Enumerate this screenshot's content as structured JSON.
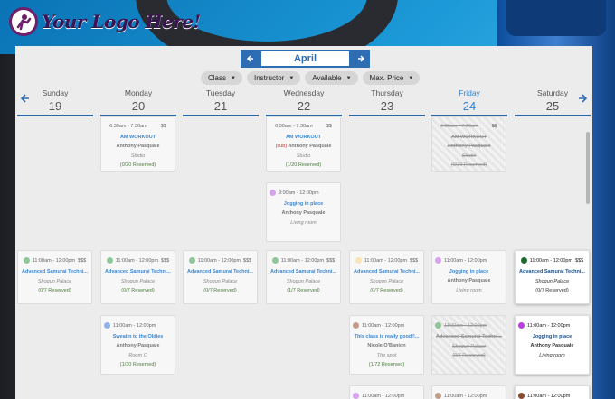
{
  "logo": {
    "text": "Your Logo Here!"
  },
  "month": {
    "name": "April",
    "prev_label": "←",
    "next_label": "→"
  },
  "filters": [
    {
      "label": "Class"
    },
    {
      "label": "Instructor"
    },
    {
      "label": "Available"
    },
    {
      "label": "Max. Price"
    }
  ],
  "days": [
    {
      "name": "Sunday",
      "num": "19"
    },
    {
      "name": "Monday",
      "num": "20"
    },
    {
      "name": "Tuesday",
      "num": "21"
    },
    {
      "name": "Wednesday",
      "num": "22"
    },
    {
      "name": "Thursday",
      "num": "23"
    },
    {
      "name": "Friday",
      "num": "24"
    },
    {
      "name": "Saturday",
      "num": "25"
    }
  ],
  "events": {
    "mon_am": {
      "time": "6:30am - 7:30am",
      "price": "$$",
      "title": "AM WORKOUT",
      "instructor": "Anthony Pasquale",
      "location": "Studio",
      "reserved": "(0/20 Reserved)"
    },
    "wed_am": {
      "time": "6:30am - 7:30am",
      "price": "$$",
      "title": "AM WORKOUT",
      "sub": "(sub)",
      "instructor": "Anthony Pasquale",
      "location": "Studio",
      "reserved": "(1/20 Reserved)"
    },
    "fri_am": {
      "time": "6:30am - 7:30am",
      "price": "$$",
      "title": "AM WORKOUT",
      "instructor": "Anthony Pasquale",
      "location": "Studio",
      "reserved": "(0/20 Reserved)"
    },
    "wed_jog": {
      "time": "9:00am - 12:00pm",
      "title": "Jogging in place",
      "instructor": "Anthony Pasquale",
      "location": "Living room",
      "color": "#d7a3ec"
    },
    "sun_samurai": {
      "time": "11:00am - 12:00pm",
      "price": "$$$",
      "title": "Advanced Samurai Techni...",
      "location": "Shogun Palace",
      "reserved": "(0/7 Reserved)",
      "color": "#8fc79a"
    },
    "mon_samurai": {
      "time": "11:00am - 12:00pm",
      "price": "$$$",
      "title": "Advanced Samurai Techni...",
      "location": "Shogun Palace",
      "reserved": "(0/7 Reserved)",
      "color": "#8fc79a"
    },
    "tue_samurai": {
      "time": "11:00am - 12:00pm",
      "price": "$$$",
      "title": "Advanced Samurai Techni...",
      "location": "Shogun Palace",
      "reserved": "(0/7 Reserved)",
      "color": "#8fc79a"
    },
    "wed_samurai": {
      "time": "11:00am - 12:00pm",
      "price": "$$$",
      "title": "Advanced Samurai Techni...",
      "location": "Shogun Palace",
      "reserved": "(1/7 Reserved)",
      "color": "#8fc79a"
    },
    "thu_samurai": {
      "time": "11:00am - 12:00pm",
      "price": "$$$",
      "title": "Advanced Samurai Techni...",
      "location": "Shogun Palace",
      "reserved": "(0/7 Reserved)",
      "color": "#fae3b5"
    },
    "fri_jog": {
      "time": "11:00am - 12:00pm",
      "title": "Jogging in place",
      "instructor": "Anthony Pasquale",
      "location": "Living room",
      "color": "#d7a3ec"
    },
    "sat_samurai": {
      "time": "11:00am - 12:00pm",
      "price": "$$$",
      "title": "Advanced Samurai Techni...",
      "location": "Shogun Palace",
      "reserved": "(0/7 Reserved)",
      "color": "#1e6b2e"
    },
    "mon_sweatin": {
      "time": "11:00am - 12:00pm",
      "title": "Sweatin to the Oldies",
      "instructor": "Anthony Pasquale",
      "location": "Room C",
      "reserved": "(1/30 Reserved)",
      "color": "#8fb3e8"
    },
    "thu_good": {
      "time": "11:00am - 12:00pm",
      "title": "This class is really good!!...",
      "instructor": "Nicole O'Banion",
      "location": "The spot",
      "reserved": "(1/72 Reserved)",
      "color": "#c19c88"
    },
    "fri_samurai_cancel": {
      "time": "11:00am - 12:00pm",
      "title": "Advanced Samurai Techni...",
      "location": "Shogun Palace",
      "reserved": "(0/7 Reserved)",
      "color": "#8fc79a"
    },
    "sat_jog": {
      "time": "11:00am - 12:00pm",
      "title": "Jogging in place",
      "instructor": "Anthony Pasquale",
      "location": "Living room",
      "color": "#bb3fe0"
    },
    "thu_bottom": {
      "time": "11:00am - 12:00pm",
      "color": "#d7a3ec"
    },
    "fri_bottom": {
      "time": "11:00am - 12:00pm",
      "color": "#c19c88"
    },
    "sat_bottom": {
      "time": "11:00am - 12:00pm",
      "color": "#8a4a2e"
    }
  }
}
